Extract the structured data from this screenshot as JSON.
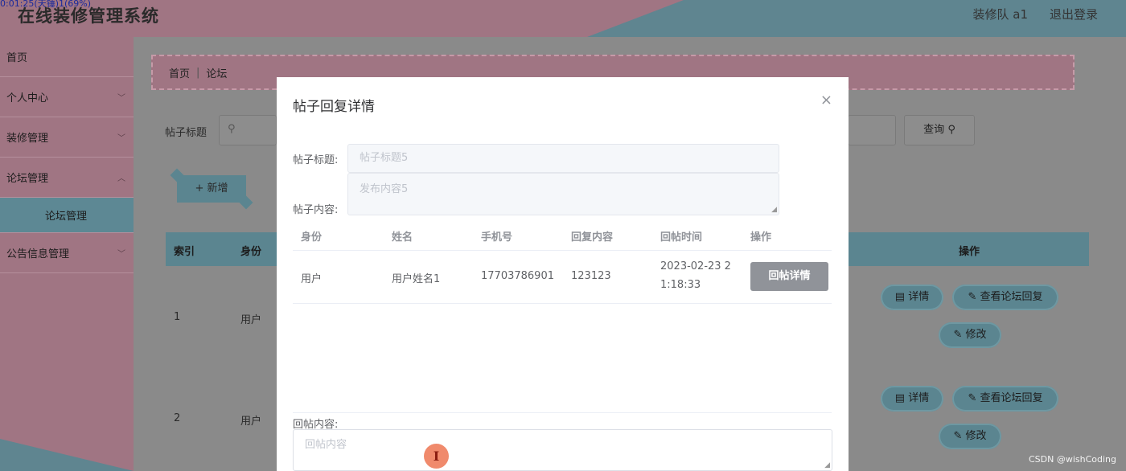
{
  "header": {
    "title": "在线装修管理系统",
    "overlay_timestamp": "0:01:25(天锤)1(69%)",
    "user": "装修队 a1",
    "logout": "退出登录"
  },
  "sidebar": {
    "items": [
      {
        "label": "首页"
      },
      {
        "label": "个人中心"
      },
      {
        "label": "装修管理"
      },
      {
        "label": "论坛管理"
      },
      {
        "label": "论坛管理"
      },
      {
        "label": "公告信息管理"
      }
    ]
  },
  "breadcrumb": {
    "home": "首页",
    "sep": "|",
    "current": "论坛"
  },
  "search": {
    "label": "帖子标题",
    "button": "查询"
  },
  "toolbar": {
    "add_label": "+ 新增"
  },
  "table": {
    "columns": [
      "索引",
      "身份",
      "操作"
    ],
    "rows": [
      {
        "index": "1",
        "identity": "用户"
      },
      {
        "index": "2",
        "identity": "用户"
      }
    ],
    "actions": {
      "detail": "详情",
      "view_replies": "查看论坛回复",
      "edit": "修改"
    }
  },
  "modal": {
    "title": "帖子回复详情",
    "close": "×",
    "post_title_label": "帖子标题:",
    "post_title_value": "帖子标题5",
    "post_content_label": "帖子内容:",
    "post_content_value": "发布内容5",
    "reply_table": {
      "columns": [
        "身份",
        "姓名",
        "手机号",
        "回复内容",
        "回帖时间",
        "操作"
      ],
      "rows": [
        {
          "identity": "用户",
          "name": "用户姓名1",
          "phone": "17703786901",
          "content": "123123",
          "time_line1": "2023-02-23 2",
          "time_line2": "1:18:33",
          "action": "回帖详情"
        }
      ]
    },
    "reply_label": "回帖内容:",
    "reply_placeholder": "回帖内容"
  },
  "watermark": "CSDN @wishCoding",
  "colors": {
    "pink": "#a07583",
    "teal": "#5f8590",
    "modal_bg": "#ffffff"
  }
}
